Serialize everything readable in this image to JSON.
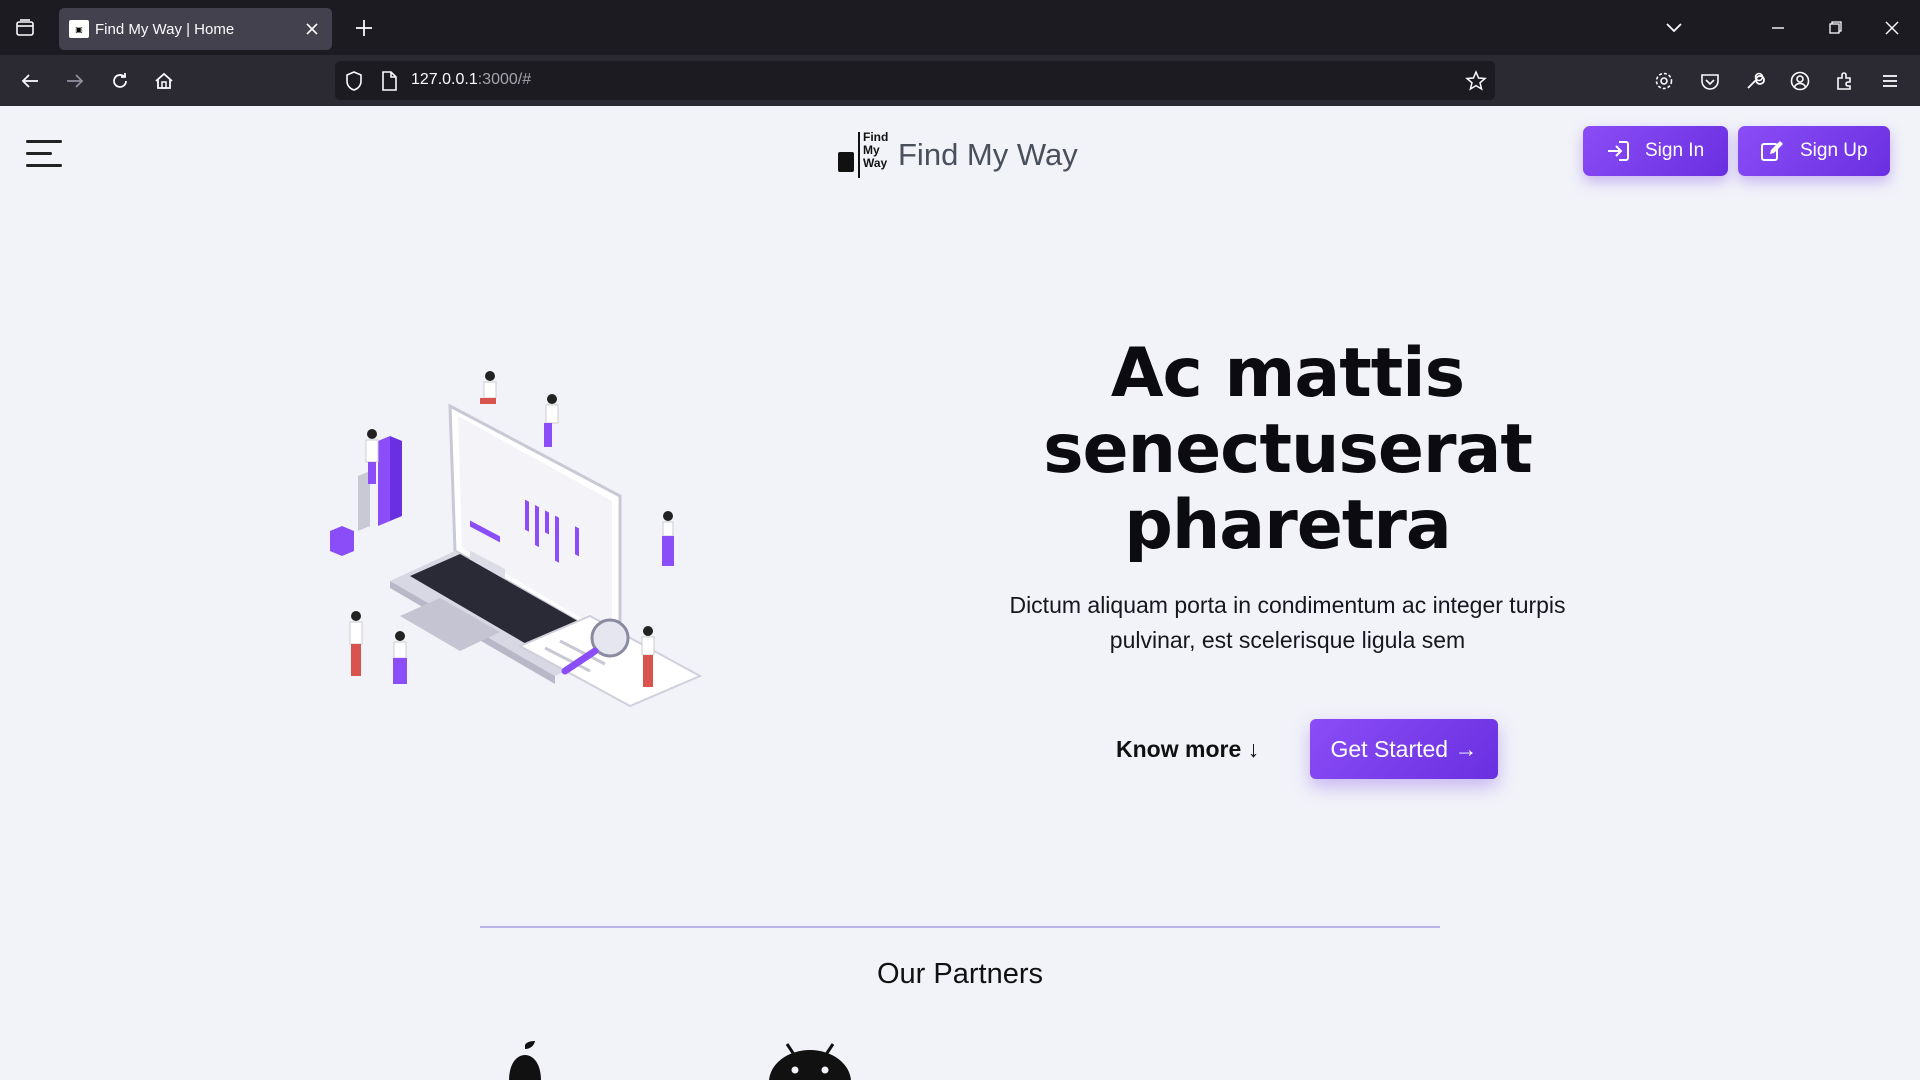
{
  "browser": {
    "tab_title": "Find My Way | Home",
    "url_host": "127.0.0.1",
    "url_rest": ":3000/#"
  },
  "header": {
    "brand_name": "Find My Way",
    "logo_text": [
      "Find",
      "My",
      "Way"
    ],
    "signin_label": "Sign In",
    "signup_label": "Sign Up"
  },
  "hero": {
    "title_lines": [
      "Ac mattis",
      "senectuserat",
      "pharetra"
    ],
    "subtitle_line1": "Dictum aliquam porta in condimentum ac integer turpis",
    "subtitle_line2": "pulvinar, est scelerisque ligula sem",
    "know_more": "Know more ↓",
    "get_started": "Get Started →"
  },
  "partners": {
    "title": "Our Partners"
  },
  "colors": {
    "accent": "#7c3aed",
    "chrome_dark": "#1c1b22",
    "chrome_mid": "#2b2a33",
    "page_bg": "#f2f3f9"
  }
}
